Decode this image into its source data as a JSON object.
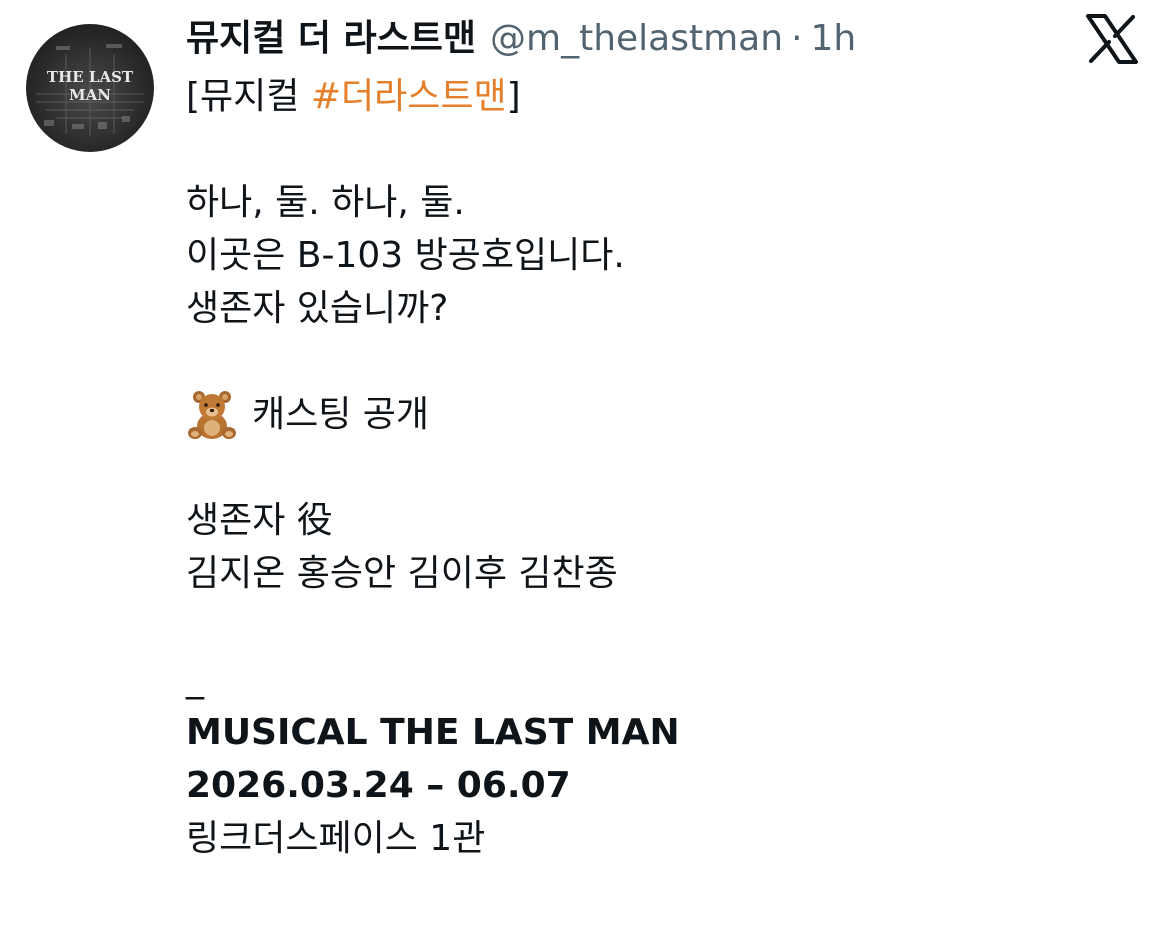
{
  "post": {
    "avatar_text": "THE LAST MAN",
    "display_name": "뮤지컬 더 라스트맨",
    "handle": "@m_thelastman",
    "separator": "·",
    "time": "1h",
    "lines": {
      "intro_bracket_open": "[",
      "intro_prefix": "뮤지컬 ",
      "intro_hashtag": "#더라스트맨",
      "intro_bracket_close": "]",
      "l1": "하나, 둘. 하나, 둘.",
      "l2": "이곳은 B-103 방공호입니다.",
      "l3": "생존자 있습니까?",
      "casting": "캐스팅 공개",
      "role": "생존자 役",
      "cast": "김지온 홍승안 김이후 김찬종",
      "dash": "_",
      "title": "MUSICAL THE LAST MAN",
      "dates": "2026.03.24 – 06.07",
      "venue": "링크더스페이스 1관"
    }
  },
  "colors": {
    "hashtag": "#e57f2a",
    "secondary": "#536471",
    "text": "#0f1419"
  },
  "icons": {
    "logo": "x-logo-icon",
    "emoji": "teddy-bear-icon"
  }
}
